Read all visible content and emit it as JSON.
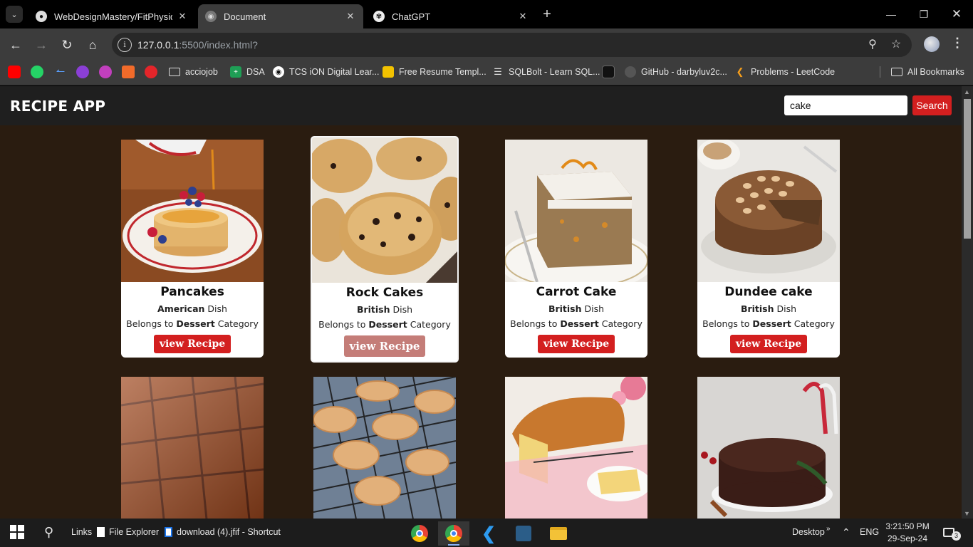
{
  "browser": {
    "tabs": [
      {
        "title": "WebDesignMastery/FitPhysique",
        "active": false
      },
      {
        "title": "Document",
        "active": true
      },
      {
        "title": "ChatGPT",
        "active": false
      }
    ],
    "url_host": "127.0.0.1",
    "url_rest": ":5500/index.html?",
    "bookmarks": [
      {
        "label": "acciojob",
        "icon": "folder-icon"
      },
      {
        "label": "DSA",
        "icon": "sheets-icon"
      },
      {
        "label": "TCS iON Digital Lear...",
        "icon": "tcs-icon"
      },
      {
        "label": "Free Resume Templ...",
        "icon": "resume-icon"
      },
      {
        "label": "SQLBolt - Learn SQL...",
        "icon": "database-icon"
      },
      {
        "label": "GitHub - darbyluv2c...",
        "icon": "github-icon"
      },
      {
        "label": "Problems - LeetCode",
        "icon": "leetcode-icon"
      }
    ],
    "all_bookmarks": "All Bookmarks"
  },
  "app": {
    "title": "RECIPE APP",
    "search_value": "cake",
    "search_button": "Search"
  },
  "recipes": [
    {
      "name": "Pancakes",
      "area": "American",
      "dish_word": "Dish",
      "belongs": "Belongs to",
      "category": "Dessert",
      "category_word": "Category",
      "button": "view Recipe"
    },
    {
      "name": "Rock Cakes",
      "area": "British",
      "dish_word": "Dish",
      "belongs": "Belongs to",
      "category": "Dessert",
      "category_word": "Category",
      "button": "view Recipe"
    },
    {
      "name": "Carrot Cake",
      "area": "British",
      "dish_word": "Dish",
      "belongs": "Belongs to",
      "category": "Dessert",
      "category_word": "Category",
      "button": "view Recipe"
    },
    {
      "name": "Dundee cake",
      "area": "British",
      "dish_word": "Dish",
      "belongs": "Belongs to",
      "category": "Dessert",
      "category_word": "Category",
      "button": "view Recipe"
    }
  ],
  "taskbar": {
    "links": "Links",
    "file_explorer": "File Explorer",
    "shortcut": "download (4).jfif - Shortcut",
    "desktop": "Desktop",
    "lang": "ENG",
    "time": "3:21:50 PM",
    "date": "29-Sep-24",
    "notifications": "3"
  },
  "colors": {
    "accent_red": "#d31f1f",
    "page_bg": "#2a1c10",
    "header_bg": "#1f1f1f"
  }
}
